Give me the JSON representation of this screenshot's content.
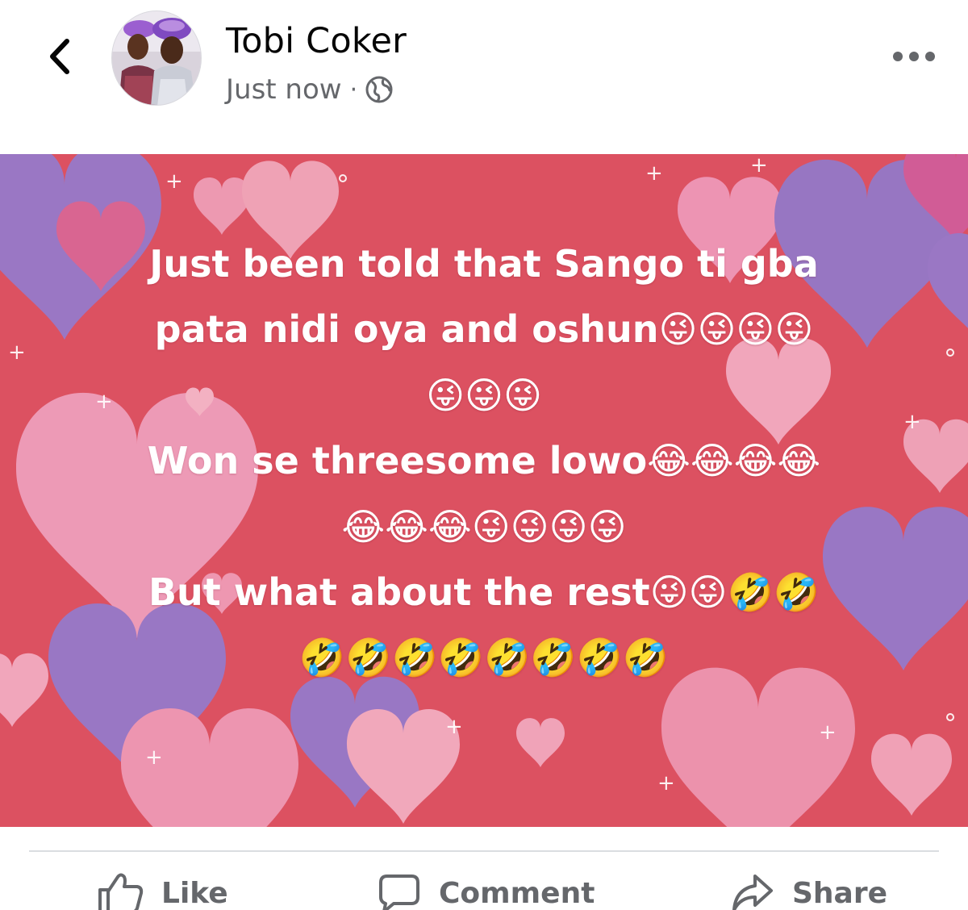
{
  "header": {
    "author_name": "Tobi Coker",
    "timestamp": "Just now",
    "separator": "·",
    "privacy_icon": "globe-icon",
    "back_icon": "chevron-left-icon",
    "more_icon": "ellipsis-icon"
  },
  "post": {
    "background_color": "#dc5161",
    "text_color": "#ffffff",
    "lines": [
      "Just been told that Sango ti gba",
      "pata nidi oya and oshun😜😜😜😜",
      "😜😜😜",
      "Won se threesome lowo😂😂😂😂",
      "😂😂😂😜😜😜😜",
      "But what about the rest😜😜🤣🤣",
      "🤣🤣🤣🤣🤣🤣🤣🤣"
    ]
  },
  "actions": {
    "like_label": "Like",
    "comment_label": "Comment",
    "share_label": "Share"
  },
  "colors": {
    "secondary_text": "#65676b",
    "primary_text": "#050505",
    "divider": "#dadde1"
  }
}
